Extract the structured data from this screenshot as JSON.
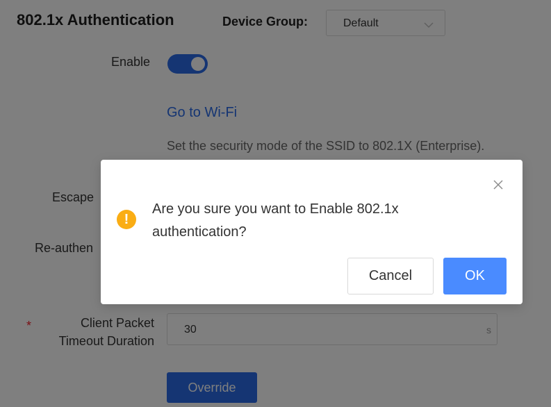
{
  "header": {
    "title": "802.1x Authentication",
    "device_group_label": "Device Group:",
    "device_group_value": "Default"
  },
  "form": {
    "enable_label": "Enable",
    "enable_state": "on",
    "go_to_wifi_link": "Go to Wi-Fi",
    "hint_text": "Set the security mode of the SSID to 802.1X (Enterprise).",
    "escape_label": "Escape",
    "reauth_label": "Re-authen",
    "client_packet_timeout": {
      "required_mark": "*",
      "label_line1": "Client Packet",
      "label_line2": "Timeout Duration",
      "value": "30",
      "unit": "s"
    },
    "override_button": "Override"
  },
  "modal": {
    "icon": "warning-icon",
    "message_line1": "Are you sure you want to Enable 802.1x",
    "message_line2": "authentication?",
    "cancel_label": "Cancel",
    "ok_label": "OK"
  },
  "colors": {
    "primary": "#2b6be6",
    "ok_button": "#4a8bff",
    "warning": "#faad14",
    "required": "#f5222d",
    "overlay": "rgba(0,0,0,0.5)"
  }
}
